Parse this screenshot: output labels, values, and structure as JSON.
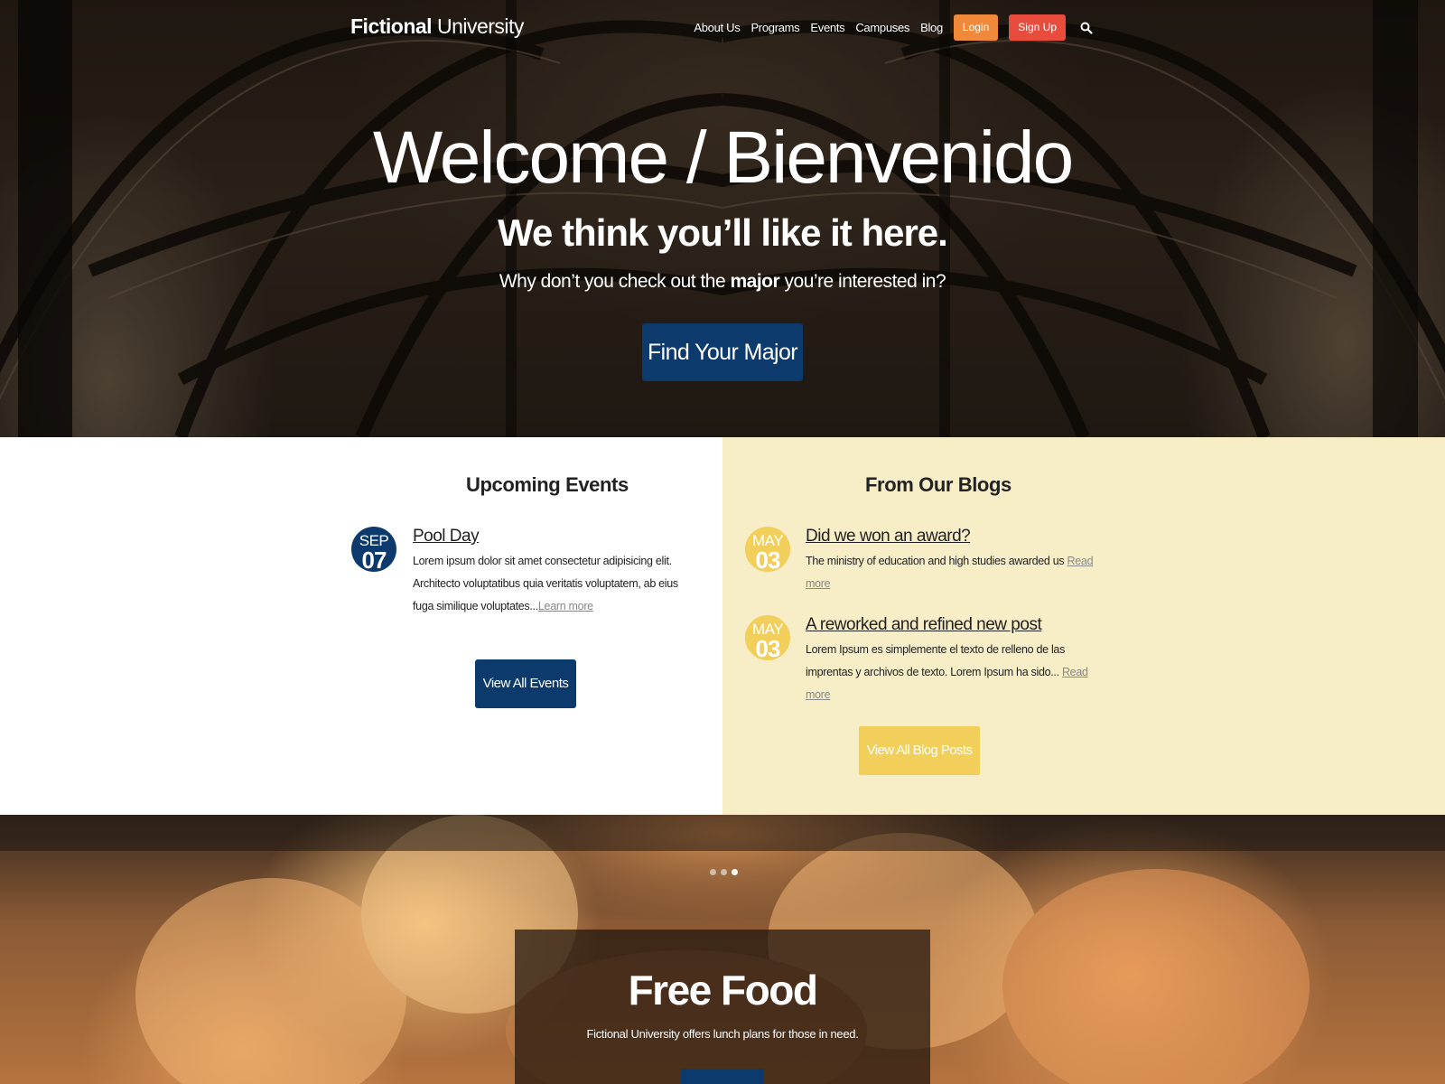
{
  "header": {
    "logo_bold": "Fictional",
    "logo_light": "University",
    "nav": [
      "About Us",
      "Programs",
      "Events",
      "Campuses",
      "Blog"
    ],
    "login_label": "Login",
    "signup_label": "Sign Up",
    "search_icon": "search-icon"
  },
  "hero": {
    "title": "Welcome / Bienvenido",
    "subtitle": "We think you’ll like it here.",
    "text_before": "Why don’t you check out the ",
    "text_bold": "major",
    "text_after": " you’re interested in?",
    "button_label": "Find Your Major"
  },
  "events": {
    "heading": "Upcoming Events",
    "items": [
      {
        "month": "SEP",
        "day": "07",
        "title": "Pool Day",
        "excerpt": "Lorem ipsum dolor sit amet consectetur adipisicing elit. Architecto voluptatibus quia veritatis voluptatem, ab eius fuga similique voluptates...",
        "more": "Learn more"
      }
    ],
    "button_label": "View All Events"
  },
  "blogs": {
    "heading": "From Our Blogs",
    "items": [
      {
        "month": "MAY",
        "day": "03",
        "title": "Did we won an award?",
        "excerpt": "The ministry of education and high studies awarded us ",
        "more": "Read more"
      },
      {
        "month": "MAY",
        "day": "03",
        "title": "A reworked and refined new post",
        "excerpt": "Lorem Ipsum es simplemente el texto de relleno de las imprentas y archivos de texto. Lorem Ipsum ha sido... ",
        "more": "Read more"
      }
    ],
    "button_label": "View All Blog Posts"
  },
  "slider": {
    "dot_count": 3,
    "active_dot": 3,
    "title": "Free Food",
    "text": "Fictional University offers lunch plans for those in need."
  },
  "colors": {
    "navy": "#0d3a6d",
    "gold": "#f2cf5b",
    "blog_bg": "#f7edc7",
    "login": "#f08a3a",
    "signup": "#e84c3d"
  }
}
